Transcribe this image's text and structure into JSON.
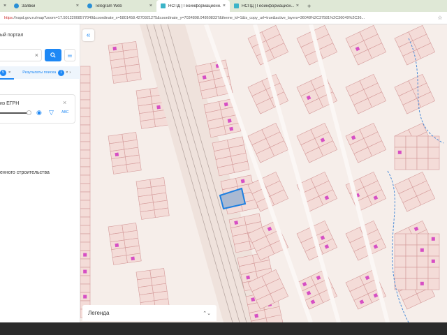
{
  "browser": {
    "tabs": [
      {
        "title": "Заявки",
        "icon": "telegram-icon",
        "active": false
      },
      {
        "title": "Telegram Web",
        "icon": "telegram-icon",
        "active": false
      },
      {
        "title": "НСПД | Геоинформационн...",
        "icon": "nspd-icon",
        "active": true
      },
      {
        "title": "НСПД | Геоинформацион...",
        "icon": "nspd-icon",
        "active": false
      }
    ],
    "new_tab": "+",
    "url_scheme": "https",
    "url_rest": "://nspd.gov.ru/map?zoom=17.50122008577049&coordinate_x=5801458.4270921275&coordinate_y=7034898.048608337&theme_id=1&is_copy_url=true&active_layers=36048%2C37581%2C36049%2C36..."
  },
  "panel": {
    "portal_title": "ый портал",
    "search_value": "",
    "tabs": [
      {
        "label": "",
        "count": "5"
      },
      {
        "label": "Результаты поиска",
        "count": "1"
      }
    ],
    "layer_title": "из ЕГРН",
    "layer_opacity": 100,
    "section_label": "енного строительства"
  },
  "map": {
    "collapse_label": "«",
    "legend_label": "Легенда",
    "selected_color": "#1e7fe0",
    "parcel_fill": "#f4dcd8",
    "parcel_stroke": "#d49a9a",
    "building_color": "#d64fc4"
  }
}
